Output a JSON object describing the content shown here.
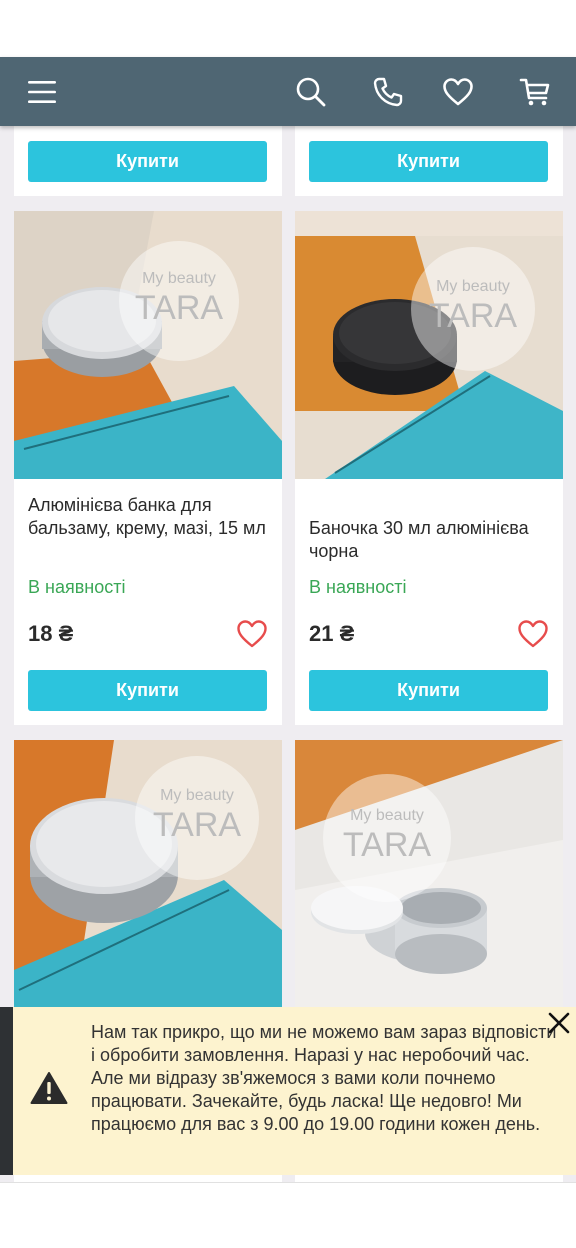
{
  "header": {
    "menu_icon": "menu-icon",
    "search_icon": "search-icon",
    "phone_icon": "phone-icon",
    "favorites_icon": "heart-icon",
    "cart_icon": "cart-icon",
    "bg_color": "#4f6673"
  },
  "buy_label": "Купити",
  "products": [
    {
      "name": "Алюмінієва банка для бальзаму, крему, мазі, 15 мл",
      "stock": "В наявності",
      "price": "18 ₴",
      "watermark": [
        "My beauty",
        "TARA"
      ]
    },
    {
      "name": "Баночка 30 мл алюмінієва чорна",
      "stock": "В наявності",
      "price": "21 ₴",
      "watermark": [
        "My beauty",
        "TARA"
      ]
    },
    {
      "name": "",
      "watermark": [
        "My beauty",
        "TARA"
      ]
    },
    {
      "name": "",
      "watermark": [
        "My beauty",
        "TARA"
      ]
    }
  ],
  "notice": {
    "icon": "warning-icon",
    "close_icon": "close-icon",
    "text": "Нам так прикро, що ми не можемо вам зараз відповісти і обробити замовлення. Наразі у нас неробочий час. Але ми відразу зв'яжемося з вами коли почнемо працювати. Зачекайте, будь ласка! Ще недовго! Ми працюємо для вас з 9.00 до 19.00 години кожен день."
  },
  "colors": {
    "accent": "#2cc4dd",
    "in_stock": "#3aa756",
    "heart": "#e74c4c",
    "notice_bg": "#fdf3cf"
  }
}
